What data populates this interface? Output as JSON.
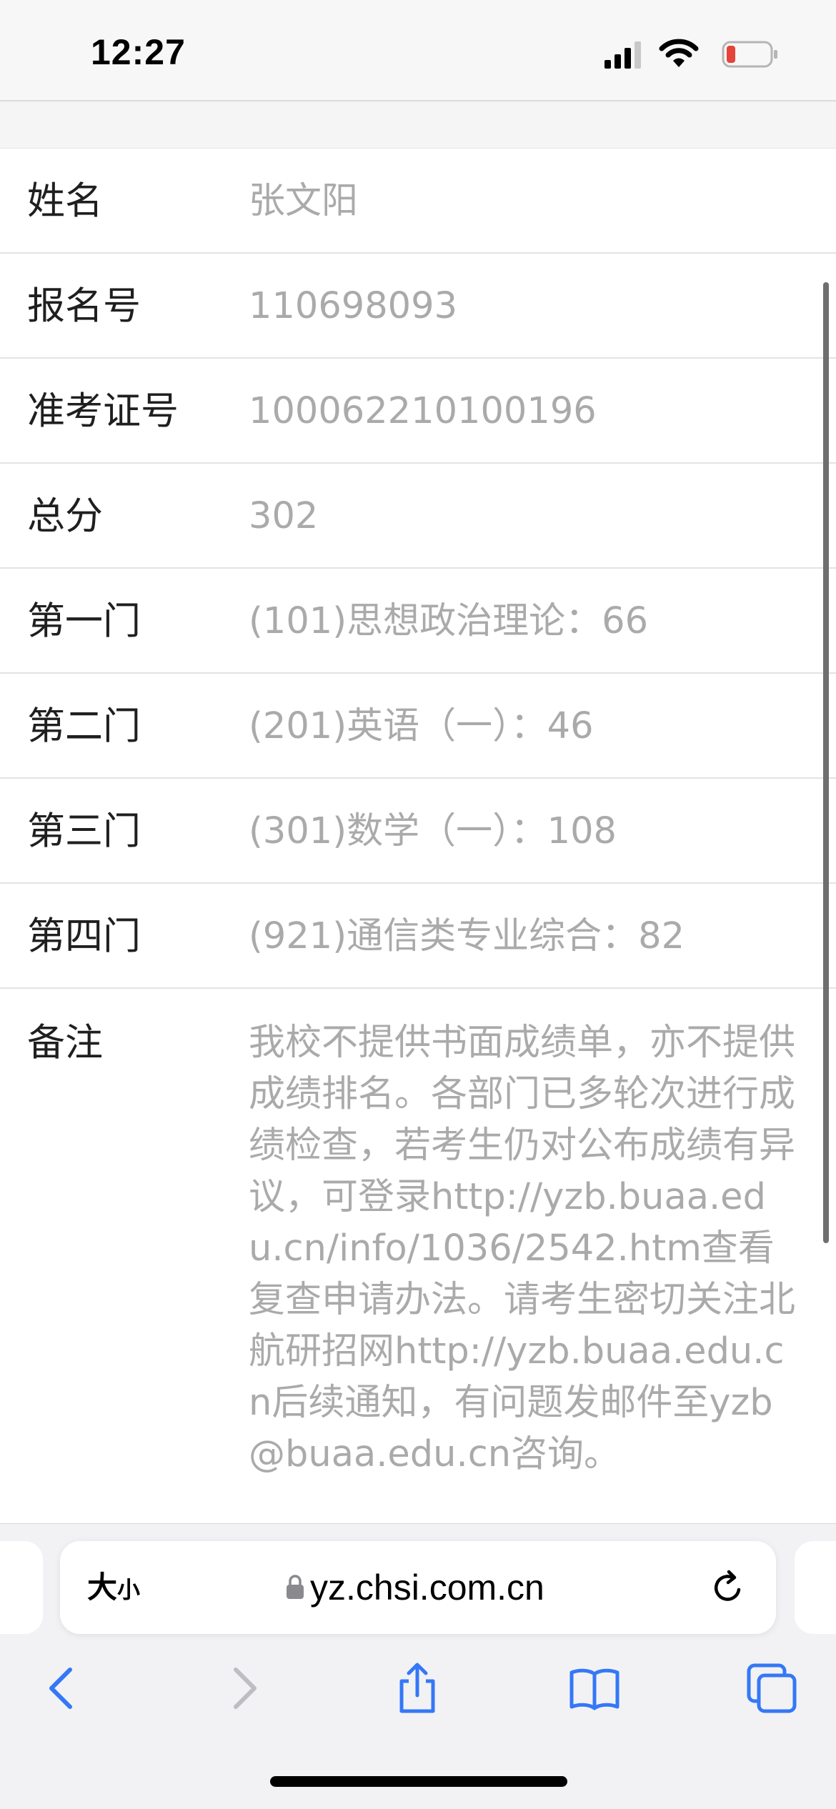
{
  "status_bar": {
    "time": "12:27"
  },
  "info_rows": [
    {
      "label": "姓名",
      "value": "张文阳"
    },
    {
      "label": "报名号",
      "value": "110698093"
    },
    {
      "label": "准考证号",
      "value": "100062210100196"
    },
    {
      "label": "总分",
      "value": "302"
    },
    {
      "label": "第一门",
      "value": "(101)思想政治理论：66"
    },
    {
      "label": "第二门",
      "value": "(201)英语（一）：46"
    },
    {
      "label": "第三门",
      "value": "(301)数学（一）：108"
    },
    {
      "label": "第四门",
      "value": "(921)通信类专业综合：82"
    }
  ],
  "note": {
    "label": "备注",
    "value": "我校不提供书面成绩单，亦不提供成绩排名。各部门已多轮次进行成绩检查，若考生仍对公布成绩有异议，可登录http://yzb.buaa.edu.cn/info/1036/2542.htm查看复查申请办法。请考生密切关注北航研招网http://yzb.buaa.edu.cn后续通知，有问题发邮件至yzb@buaa.edu.cn咨询。"
  },
  "browser": {
    "text_size_large": "大",
    "text_size_small": "小",
    "url": "yz.chsi.com.cn"
  },
  "colors": {
    "accent": "#3478f6",
    "label_text": "#1f1f1f",
    "value_text": "#aaaaaa",
    "battery_low": "#e5443a"
  },
  "icons": {
    "signal": "signal-icon",
    "wifi": "wifi-icon",
    "battery": "battery-icon",
    "lock": "lock-icon",
    "reload": "reload-icon",
    "back": "chevron-left-icon",
    "forward": "chevron-right-icon",
    "share": "share-icon",
    "bookmarks": "book-icon",
    "tabs": "tabs-icon"
  }
}
